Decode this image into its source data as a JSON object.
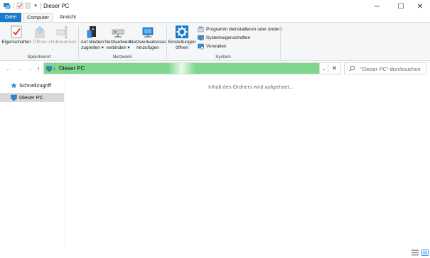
{
  "window": {
    "title": "Dieser PC",
    "minimize": "─",
    "maximize": "☐",
    "close": "✕"
  },
  "tabs": [
    {
      "label": "Datei"
    },
    {
      "label": "Computer"
    },
    {
      "label": "Ansicht"
    }
  ],
  "ribbon": {
    "speicherort": {
      "label": "Speicherort",
      "buttons": [
        {
          "label1": "Eigenschaften",
          "label2": "",
          "icon": "checkmark-properties-icon",
          "enabled": true
        },
        {
          "label1": "Öffnen",
          "label2": "",
          "icon": "open-icon",
          "enabled": false
        },
        {
          "label1": "Umbenennen",
          "label2": "",
          "icon": "rename-icon",
          "enabled": false
        }
      ]
    },
    "netzwerk": {
      "label": "Netzwerk",
      "buttons": [
        {
          "label1": "Auf Medien",
          "label2": "zugreifen ▾",
          "icon": "media-access-icon"
        },
        {
          "label1": "Netzlaufwerk",
          "label2": "verbinden ▾",
          "icon": "network-drive-icon"
        },
        {
          "label1": "Netzwerkadresse",
          "label2": "hinzufügen",
          "icon": "network-location-icon"
        }
      ]
    },
    "system": {
      "label": "System",
      "big": {
        "label1": "Einstellungen",
        "label2": "öffnen",
        "icon": "settings-gear-icon"
      },
      "small": [
        {
          "label": "Programm deinstallieren oder ändern",
          "icon": "uninstall-icon"
        },
        {
          "label": "Systemeigenschaften",
          "icon": "system-properties-icon"
        },
        {
          "label": "Verwalten",
          "icon": "manage-icon"
        }
      ]
    }
  },
  "address": {
    "path": "Dieser PC",
    "search_placeholder": "\"Dieser PC\" durchsuchen"
  },
  "nav": {
    "back": "←",
    "forward": "→",
    "recent": "⌄",
    "up": "↑",
    "items": [
      {
        "label": "Schnellzugriff"
      },
      {
        "label": "Dieser PC"
      }
    ]
  },
  "content": {
    "loading": "Inhalt des Ordners wird aufgelistet..."
  },
  "colors": {
    "file_tab": "#1979ca",
    "address_progress": "#7ed68f",
    "selection": "#d9d9d9"
  }
}
